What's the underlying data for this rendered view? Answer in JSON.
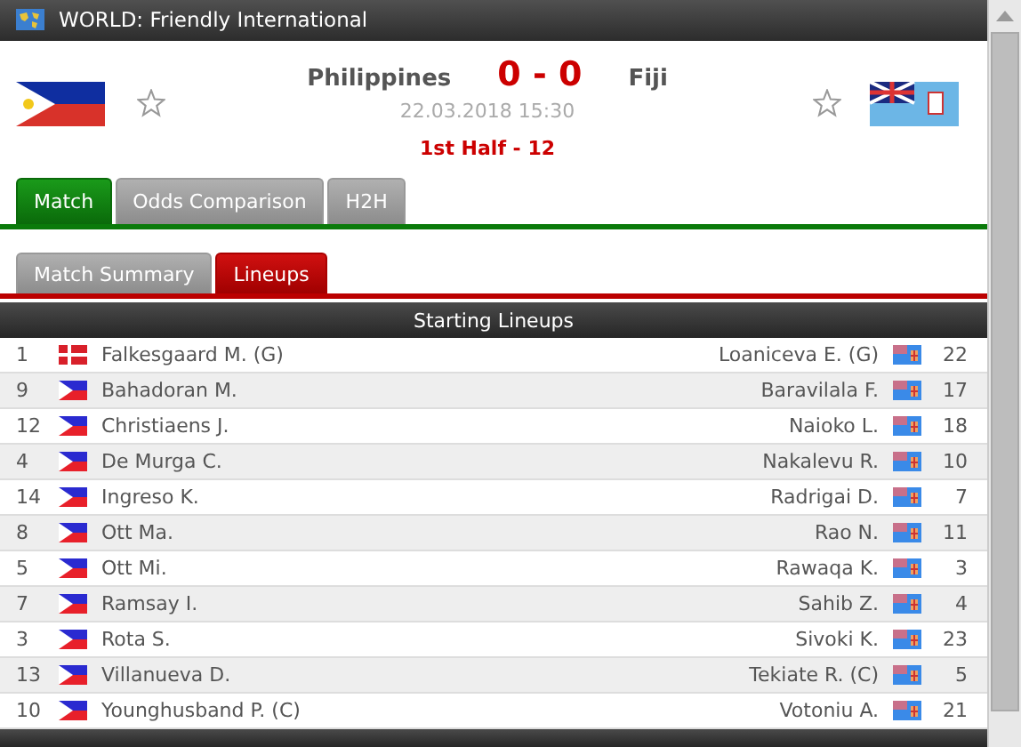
{
  "competition": {
    "title": "WORLD: Friendly International"
  },
  "match": {
    "home": {
      "name": "Philippines",
      "flag": {
        "kind": "ph"
      },
      "favorite": false
    },
    "away": {
      "name": "Fiji",
      "flag": {
        "kind": "fj"
      },
      "favorite": false
    },
    "score": "0 - 0",
    "datetime": "22.03.2018 15:30",
    "status": "1st Half - 12"
  },
  "tabs": [
    {
      "label": "Match",
      "selected": true
    },
    {
      "label": "Odds Comparison",
      "selected": false
    },
    {
      "label": "H2H",
      "selected": false
    }
  ],
  "subtabs": [
    {
      "label": "Match Summary",
      "selected": false
    },
    {
      "label": "Lineups",
      "selected": true
    }
  ],
  "section": {
    "title": "Starting Lineups"
  },
  "lineups": [
    {
      "home_number": "1",
      "home_flag": {
        "kind": "dk"
      },
      "home_player": "Falkesgaard M. (G)",
      "away_player": "Loaniceva E. (G)",
      "away_flag": {
        "kind": "fj"
      },
      "away_number": "22"
    },
    {
      "home_number": "9",
      "home_flag": {
        "kind": "ph"
      },
      "home_player": "Bahadoran M.",
      "away_player": "Baravilala F.",
      "away_flag": {
        "kind": "fj"
      },
      "away_number": "17"
    },
    {
      "home_number": "12",
      "home_flag": {
        "kind": "ph"
      },
      "home_player": "Christiaens J.",
      "away_player": "Naioko L.",
      "away_flag": {
        "kind": "fj"
      },
      "away_number": "18"
    },
    {
      "home_number": "4",
      "home_flag": {
        "kind": "ph"
      },
      "home_player": "De Murga C.",
      "away_player": "Nakalevu R.",
      "away_flag": {
        "kind": "fj"
      },
      "away_number": "10"
    },
    {
      "home_number": "14",
      "home_flag": {
        "kind": "ph"
      },
      "home_player": "Ingreso K.",
      "away_player": "Radrigai D.",
      "away_flag": {
        "kind": "fj"
      },
      "away_number": "7"
    },
    {
      "home_number": "8",
      "home_flag": {
        "kind": "ph"
      },
      "home_player": "Ott Ma.",
      "away_player": "Rao N.",
      "away_flag": {
        "kind": "fj"
      },
      "away_number": "11"
    },
    {
      "home_number": "5",
      "home_flag": {
        "kind": "ph"
      },
      "home_player": "Ott Mi.",
      "away_player": "Rawaqa K.",
      "away_flag": {
        "kind": "fj"
      },
      "away_number": "3"
    },
    {
      "home_number": "7",
      "home_flag": {
        "kind": "ph"
      },
      "home_player": "Ramsay I.",
      "away_player": "Sahib Z.",
      "away_flag": {
        "kind": "fj"
      },
      "away_number": "4"
    },
    {
      "home_number": "3",
      "home_flag": {
        "kind": "ph"
      },
      "home_player": "Rota S.",
      "away_player": "Sivoki K.",
      "away_flag": {
        "kind": "fj"
      },
      "away_number": "23"
    },
    {
      "home_number": "13",
      "home_flag": {
        "kind": "ph"
      },
      "home_player": "Villanueva D.",
      "away_player": "Tekiate R. (C)",
      "away_flag": {
        "kind": "fj"
      },
      "away_number": "5"
    },
    {
      "home_number": "10",
      "home_flag": {
        "kind": "ph"
      },
      "home_player": "Younghusband P. (C)",
      "away_player": "Votoniu A.",
      "away_flag": {
        "kind": "fj"
      },
      "away_number": "21"
    }
  ]
}
